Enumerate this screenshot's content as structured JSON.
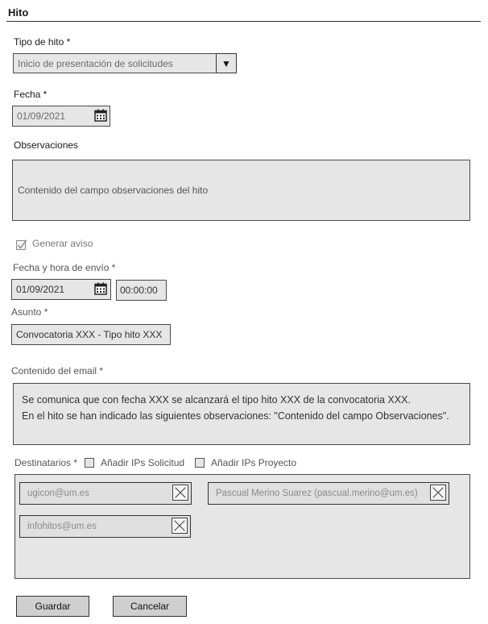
{
  "page": {
    "title": "Hito"
  },
  "tipo_hito": {
    "label": "Tipo de hito *",
    "value": "Inicio de presentación de solicitudes",
    "caret": "▼"
  },
  "fecha": {
    "label": "Fecha *",
    "value": "01/09/2021"
  },
  "observaciones": {
    "label": "Observaciones",
    "value": "Contenido del campo observaciones del hito"
  },
  "aviso": {
    "label": "Generar aviso",
    "checked": true
  },
  "envio": {
    "label": "Fecha y hora de envío *",
    "date": "01/09/2021",
    "time": "00:00:00"
  },
  "asunto": {
    "label": "Asunto *",
    "value": "Convocatoria XXX - Tipo hito XXX"
  },
  "email": {
    "label": "Contenido del email *",
    "line1": "Se comunica que con fecha XXX se alcanzará el tipo hito XXX de la convocatoria XXX.",
    "line2": "En el hito se han indicado las siguientes observaciones: \"Contenido del campo Observaciones\"."
  },
  "destinatarios": {
    "label": "Destinatarios *",
    "add_ips_solicitud": "Añadir IPs Solicitud",
    "add_ips_proyecto": "Añadir IPs Proyecto",
    "chips": [
      "ugicon@um.es",
      "Pascual Merino Suarez (pascual.merino@um.es)",
      "infohitos@um.es"
    ]
  },
  "actions": {
    "save": "Guardar",
    "cancel": "Cancelar"
  }
}
